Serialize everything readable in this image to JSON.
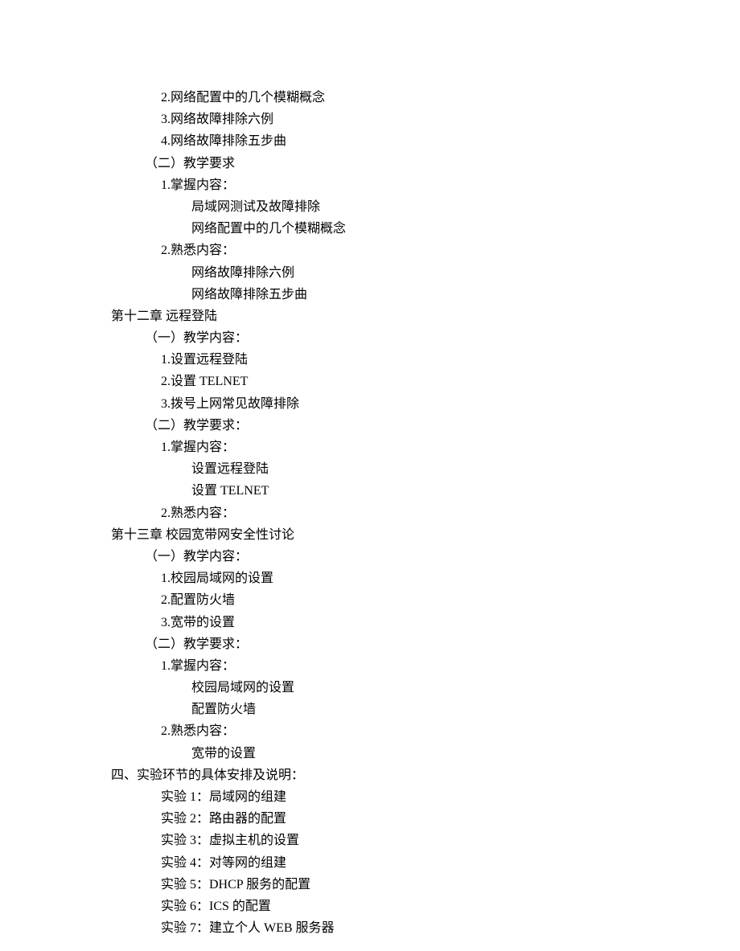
{
  "lines": [
    {
      "indent": 2,
      "text": "2.网络配置中的几个模糊概念"
    },
    {
      "indent": 2,
      "text": "3.网络故障排除六例"
    },
    {
      "indent": 2,
      "text": "4.网络故障排除五步曲"
    },
    {
      "indent": 1,
      "text": "（二）教学要求"
    },
    {
      "indent": 2,
      "text": "1.掌握内容："
    },
    {
      "indent": 3,
      "text": "局域网测试及故障排除"
    },
    {
      "indent": 3,
      "text": "网络配置中的几个模糊概念"
    },
    {
      "indent": 2,
      "text": "2.熟悉内容："
    },
    {
      "indent": 3,
      "text": "网络故障排除六例"
    },
    {
      "indent": 3,
      "text": "网络故障排除五步曲"
    },
    {
      "indent": 0,
      "text": "第十二章  远程登陆"
    },
    {
      "indent": 1,
      "text": "（一）教学内容："
    },
    {
      "indent": 2,
      "text": "1.设置远程登陆"
    },
    {
      "indent": 2,
      "text": "2.设置 TELNET"
    },
    {
      "indent": 2,
      "text": "3.拨号上网常见故障排除"
    },
    {
      "indent": 1,
      "text": "（二）教学要求："
    },
    {
      "indent": 2,
      "text": "1.掌握内容："
    },
    {
      "indent": 3,
      "text": "设置远程登陆"
    },
    {
      "indent": 3,
      "text": "设置 TELNET"
    },
    {
      "indent": 2,
      "text": "2.熟悉内容："
    },
    {
      "indent": 0,
      "text": "第十三章  校园宽带网安全性讨论"
    },
    {
      "indent": 1,
      "text": "（一）教学内容："
    },
    {
      "indent": 2,
      "text": "1.校园局域网的设置"
    },
    {
      "indent": 2,
      "text": "2.配置防火墙"
    },
    {
      "indent": 2,
      "text": "3.宽带的设置"
    },
    {
      "indent": 1,
      "text": "（二）教学要求："
    },
    {
      "indent": 2,
      "text": "1.掌握内容："
    },
    {
      "indent": 3,
      "text": "校园局域网的设置"
    },
    {
      "indent": 3,
      "text": "配置防火墙"
    },
    {
      "indent": 2,
      "text": "2.熟悉内容："
    },
    {
      "indent": 3,
      "text": "宽带的设置"
    },
    {
      "indent": 0,
      "text": "四、实验环节的具体安排及说明："
    },
    {
      "indent": 2,
      "text": "实验 1：局域网的组建"
    },
    {
      "indent": 2,
      "text": "实验 2：路由器的配置"
    },
    {
      "indent": 2,
      "text": "实验 3：虚拟主机的设置"
    },
    {
      "indent": 2,
      "text": "实验 4：对等网的组建"
    },
    {
      "indent": 2,
      "text": "实验 5：DHCP 服务的配置"
    },
    {
      "indent": 2,
      "text": "实验 6：ICS 的配置"
    },
    {
      "indent": 2,
      "text": "实验 7：建立个人 WEB 服务器"
    }
  ]
}
